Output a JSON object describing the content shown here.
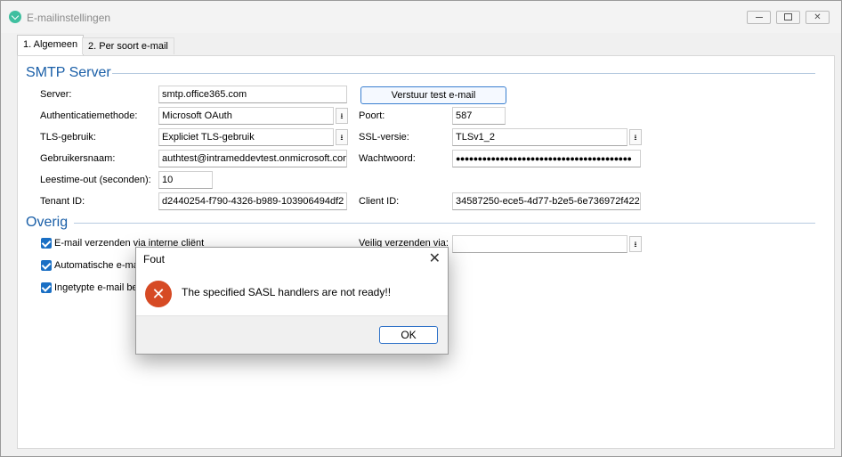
{
  "window": {
    "title": "E-mailinstellingen",
    "minimize_icon": "minimize-icon",
    "maximize_icon": "maximize-icon",
    "close_icon": "close-icon"
  },
  "tabs": [
    {
      "label": "1. Algemeen",
      "active": true
    },
    {
      "label": "2. Per soort e-mail",
      "active": false
    }
  ],
  "smtp": {
    "section_title": "SMTP Server",
    "server_label": "Server:",
    "server_value": "smtp.office365.com",
    "test_button": "Verstuur test e-mail",
    "auth_label": "Authenticatiemethode:",
    "auth_value": "Microsoft OAuth",
    "port_label": "Poort:",
    "port_value": "587",
    "tls_label": "TLS-gebruik:",
    "tls_value": "Expliciet TLS-gebruik",
    "ssl_label": "SSL-versie:",
    "ssl_value": "TLSv1_2",
    "user_label": "Gebruikersnaam:",
    "user_value": "authtest@intrameddevtest.onmicrosoft.com",
    "password_label": "Wachtwoord:",
    "password_value": "●●●●●●●●●●●●●●●●●●●●●●●●●●●●●●●●●●●●●●●●",
    "timeout_label": "Leestime-out (seconden):",
    "timeout_value": "10",
    "tenant_label": "Tenant ID:",
    "tenant_value": "d2440254-f790-4326-b989-103906494df2",
    "client_label": "Client ID:",
    "client_value": "34587250-ece5-4d77-b2e5-6e736972f422"
  },
  "overig": {
    "section_title": "Overig",
    "check1_label": "E-mail verzenden via interne cliënt",
    "check2_label": "Automatische e-mail",
    "check3_label": "Ingetypte e-mail be",
    "safe_send_label": "Veilig verzenden via:",
    "safe_send_value": ""
  },
  "dialog": {
    "title": "Fout",
    "message": "The specified SASL handlers are not ready!!",
    "ok_label": "OK",
    "error_icon_glyph": "✕",
    "close_glyph": "✕"
  },
  "icons": {
    "dropdown": "⭳"
  },
  "colors": {
    "section_title": "#1a5fa8",
    "checkbox": "#1a6fc4",
    "error": "#d64a24",
    "accent_button": "#3a7fd0"
  }
}
